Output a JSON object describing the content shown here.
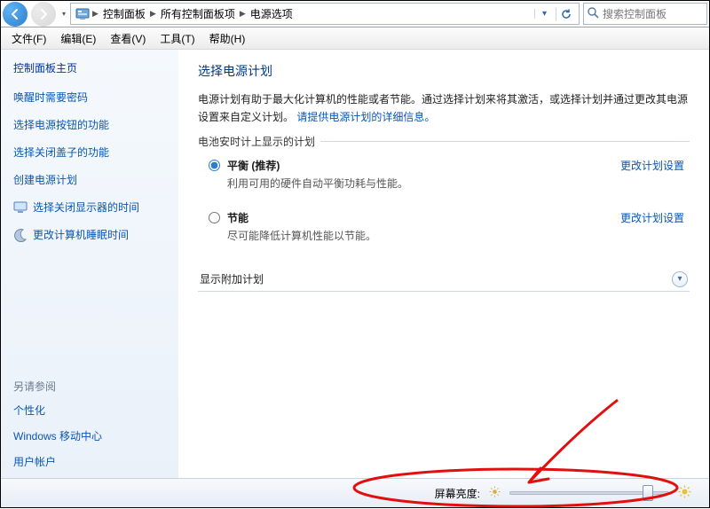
{
  "addressbar": {
    "crumbs": [
      "控制面板",
      "所有控制面板项",
      "电源选项"
    ]
  },
  "search": {
    "placeholder": "搜索控制面板"
  },
  "menu": {
    "file": "文件(F)",
    "edit": "编辑(E)",
    "view": "查看(V)",
    "tools": "工具(T)",
    "help": "帮助(H)"
  },
  "sidebar": {
    "home": "控制面板主页",
    "items": [
      "唤醒时需要密码",
      "选择电源按钮的功能",
      "选择关闭盖子的功能",
      "创建电源计划",
      "选择关闭显示器的时间",
      "更改计算机睡眠时间"
    ],
    "see_also_header": "另请参阅",
    "see_also": [
      "个性化",
      "Windows 移动中心",
      "用户帐户"
    ]
  },
  "main": {
    "title": "选择电源计划",
    "description_pre": "电源计划有助于最大化计算机的性能或者节能。通过选择计划来将其激活，或选择计划并通过更改其电源设置来自定义计划。",
    "description_link": "请提供电源计划的详细信息。",
    "group_label": "电池安时计上显示的计划",
    "plans": [
      {
        "name": "平衡 (推荐)",
        "desc": "利用可用的硬件自动平衡功耗与性能。",
        "link": "更改计划设置",
        "checked": true
      },
      {
        "name": "节能",
        "desc": "尽可能降低计算机性能以节能。",
        "link": "更改计划设置",
        "checked": false
      }
    ],
    "expander_label": "显示附加计划"
  },
  "bottom": {
    "label": "屏幕亮度:"
  }
}
